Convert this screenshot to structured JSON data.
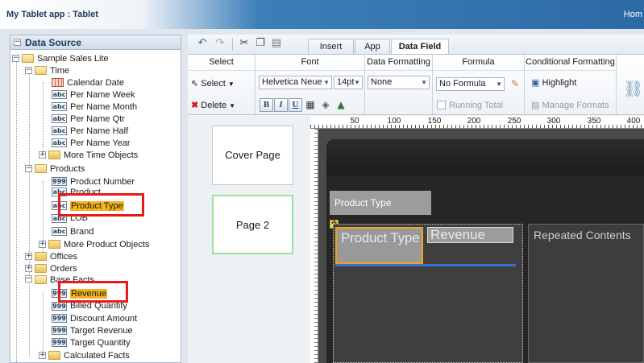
{
  "window": {
    "title": "My Tablet app : Tablet",
    "home_link": "Hom"
  },
  "data_source": {
    "header": "Data Source",
    "root": "Sample Sales Lite",
    "time_folder": "Time",
    "time_items": [
      "Calendar Date",
      "Per Name Week",
      "Per Name Month",
      "Per Name Qtr",
      "Per Name Half",
      "Per Name Year"
    ],
    "more_time": "More Time Objects",
    "products_folder": "Products",
    "product_items": [
      "Product Number",
      "Product",
      "Product Type",
      "LOB",
      "Brand"
    ],
    "more_product": "More Product Objects",
    "offices": "Offices",
    "orders": "Orders",
    "base_facts": "Base Facts",
    "fact_items": [
      "Revenue",
      "Billed Quantity",
      "Discount Amount",
      "Target Revenue",
      "Target Quantity"
    ],
    "calculated_facts": "Calculated Facts",
    "icons": {
      "attribute": "abc",
      "measure": "999"
    }
  },
  "tabs": [
    "Insert",
    "App",
    "Data Field"
  ],
  "ribbon": {
    "select_group": "Select",
    "select_btn": "Select",
    "delete_btn": "Delete",
    "font_group": "Font",
    "font_name": "Helvetica Neue",
    "font_size": "14pt",
    "bold": "B",
    "italic": "I",
    "underline": "U",
    "data_formatting_group": "Data Formatting",
    "data_format": "None",
    "formula_group": "Formula",
    "formula_value": "No Formula",
    "running_total": "Running Total",
    "conditional_group": "Conditional Formatting",
    "highlight": "Highlight",
    "manage_formats": "Manage Formats"
  },
  "pages": [
    "Cover Page",
    "Page 2"
  ],
  "ruler": [
    "50",
    "100",
    "150",
    "200",
    "250",
    "300",
    "350",
    "400"
  ],
  "canvas": {
    "product_type_header": "Product Type",
    "col_product_type": "Product Type",
    "col_revenue": "Revenue",
    "repeated": "Repeated Contents"
  },
  "colors": {
    "highlight": "#f6b31c",
    "callout": "#e8191b",
    "selection": "#f0a31a"
  }
}
